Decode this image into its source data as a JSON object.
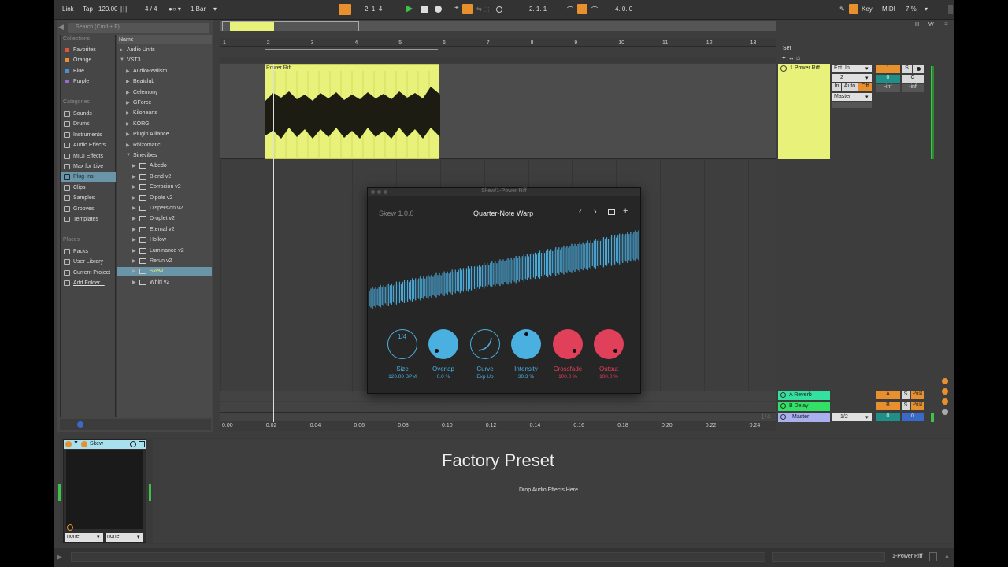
{
  "transport": {
    "link": "Link",
    "tap": "Tap",
    "tempo": "120.00",
    "meter": "4 / 4",
    "quantize": "1 Bar",
    "position": "2.   1.   4",
    "loop_start": "2.   1.   1",
    "loop_length": "4.   0.   0",
    "key": "Key",
    "midi": "MIDI",
    "cpu": "7 %"
  },
  "browser": {
    "search_placeholder": "Search (Cmd + F)",
    "collections_header": "Collections",
    "collections": [
      {
        "label": "Favorites",
        "color": "#e0533d"
      },
      {
        "label": "Orange",
        "color": "#e8902d"
      },
      {
        "label": "Blue",
        "color": "#4a8fd6"
      },
      {
        "label": "Purple",
        "color": "#9a6ad6"
      }
    ],
    "categories_header": "Categories",
    "categories": [
      "Sounds",
      "Drums",
      "Instruments",
      "Audio Effects",
      "MIDI Effects",
      "Max for Live",
      "Plug-Ins",
      "Clips",
      "Samples",
      "Grooves",
      "Templates"
    ],
    "places_header": "Places",
    "places": [
      "Packs",
      "User Library",
      "Current Project",
      "Add Folder..."
    ],
    "name_header": "Name",
    "tree": [
      {
        "label": "Audio Units",
        "depth": 0
      },
      {
        "label": "VST3",
        "depth": 0,
        "open": true
      },
      {
        "label": "AudioRealism",
        "depth": 1
      },
      {
        "label": "Beatclub",
        "depth": 1
      },
      {
        "label": "Celemony",
        "depth": 1
      },
      {
        "label": "GForce",
        "depth": 1
      },
      {
        "label": "Kilohearts",
        "depth": 1
      },
      {
        "label": "KORG",
        "depth": 1
      },
      {
        "label": "Plugin Alliance",
        "depth": 1
      },
      {
        "label": "Rhizomatic",
        "depth": 1
      },
      {
        "label": "Sinevibes",
        "depth": 1,
        "open": true
      },
      {
        "label": "Albedo",
        "depth": 2
      },
      {
        "label": "Blend v2",
        "depth": 2
      },
      {
        "label": "Corrosion v2",
        "depth": 2
      },
      {
        "label": "Dipole v2",
        "depth": 2
      },
      {
        "label": "Dispersion v2",
        "depth": 2
      },
      {
        "label": "Droplet v2",
        "depth": 2
      },
      {
        "label": "Eternal v2",
        "depth": 2
      },
      {
        "label": "Hollow",
        "depth": 2
      },
      {
        "label": "Luminance v2",
        "depth": 2
      },
      {
        "label": "Rerun v2",
        "depth": 2
      },
      {
        "label": "Skew",
        "depth": 2,
        "selected": true
      },
      {
        "label": "Whirl v2",
        "depth": 2
      }
    ]
  },
  "arrangement": {
    "bars": [
      "1",
      "2",
      "3",
      "4",
      "5",
      "6",
      "7",
      "8",
      "9",
      "10",
      "11",
      "12",
      "13"
    ],
    "times": [
      "0:00",
      "0:02",
      "0:04",
      "0:06",
      "0:08",
      "0:10",
      "0:12",
      "0:14",
      "0:16",
      "0:18",
      "0:20",
      "0:22",
      "0:24"
    ],
    "clip_name": "Power Riff",
    "zoom_label": "1/4"
  },
  "plugin": {
    "window_title": "Skew/1-Power Riff",
    "version": "Skew 1.0.0",
    "preset": "Quarter-Note Warp",
    "knobs": [
      {
        "label": "Size",
        "value": "120.00 BPM",
        "color": "#4ab0e0",
        "style": "ring",
        "display": "1/4"
      },
      {
        "label": "Overlap",
        "value": "0.0 %",
        "color": "#4ab0e0",
        "style": "fill"
      },
      {
        "label": "Curve",
        "value": "Exp Up",
        "color": "#4ab0e0",
        "style": "ring"
      },
      {
        "label": "Intensity",
        "value": "30.3 %",
        "color": "#4ab0e0",
        "style": "fill"
      },
      {
        "label": "Crossfade",
        "value": "100.0 %",
        "color": "#e0405a",
        "style": "fill"
      },
      {
        "label": "Output",
        "value": "100.0 %",
        "color": "#e0405a",
        "style": "fill"
      }
    ]
  },
  "mixer": {
    "set_label": "Set",
    "track_name": "1 Power Riff",
    "input_type": "Ext. In",
    "input_channel": "2",
    "monitor": [
      "In",
      "Auto",
      "Off"
    ],
    "output": "Master",
    "track_number": "1",
    "solo": "S",
    "volume": "0",
    "pan": "C",
    "meter_a": "-inf",
    "meter_b": "-inf",
    "returns": [
      {
        "name": "A Reverb",
        "color": "#33e0a0",
        "letter": "A"
      },
      {
        "name": "B Delay",
        "color": "#33e066",
        "letter": "B"
      },
      {
        "name": "Master",
        "color": "#a8b0f0",
        "letter": "0"
      }
    ],
    "master_ratio": "1/2",
    "post": "Post"
  },
  "device": {
    "name": "Skew",
    "factory_preset": "Factory Preset",
    "drop_hint": "Drop Audio Effects Here",
    "in_select": "none",
    "out_select": "none"
  },
  "status": {
    "track": "1-Power Riff"
  }
}
